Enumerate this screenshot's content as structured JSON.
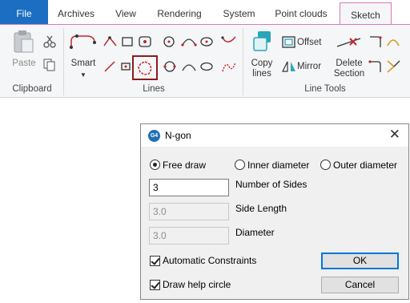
{
  "tabs": {
    "file": "File",
    "archives": "Archives",
    "view": "View",
    "rendering": "Rendering",
    "system": "System",
    "point_clouds": "Point clouds",
    "sketch": "Sketch"
  },
  "ribbon": {
    "clipboard": {
      "paste": "Paste",
      "group_label": "Clipboard"
    },
    "lines": {
      "smart": "Smart",
      "group_label": "Lines"
    },
    "line_tools": {
      "copy_lines": "Copy lines",
      "offset": "Offset",
      "mirror": "Mirror",
      "delete_section": "Delete Section",
      "group_label": "Line Tools"
    }
  },
  "dialog": {
    "app_badge": "G4",
    "title": "N-gon",
    "close": "✕",
    "modes": {
      "free_draw": "Free draw",
      "inner_diameter": "Inner diameter",
      "outer_diameter": "Outer diameter",
      "selected": "free_draw"
    },
    "number_of_sides": {
      "value": "3",
      "label": "Number of Sides"
    },
    "side_length": {
      "value": "3.0",
      "label": "Side Length"
    },
    "diameter": {
      "value": "3.0",
      "label": "Diameter"
    },
    "automatic_constraints": {
      "label": "Automatic Constraints",
      "checked": true
    },
    "draw_help_circle": {
      "label": "Draw help circle",
      "checked": true
    },
    "ok": "OK",
    "cancel": "Cancel"
  },
  "colors": {
    "file_tab": "#1b6ec2",
    "sketch_accent": "#d67ab8",
    "tool_red": "#c0262c",
    "selection": "#8b1c1c"
  }
}
